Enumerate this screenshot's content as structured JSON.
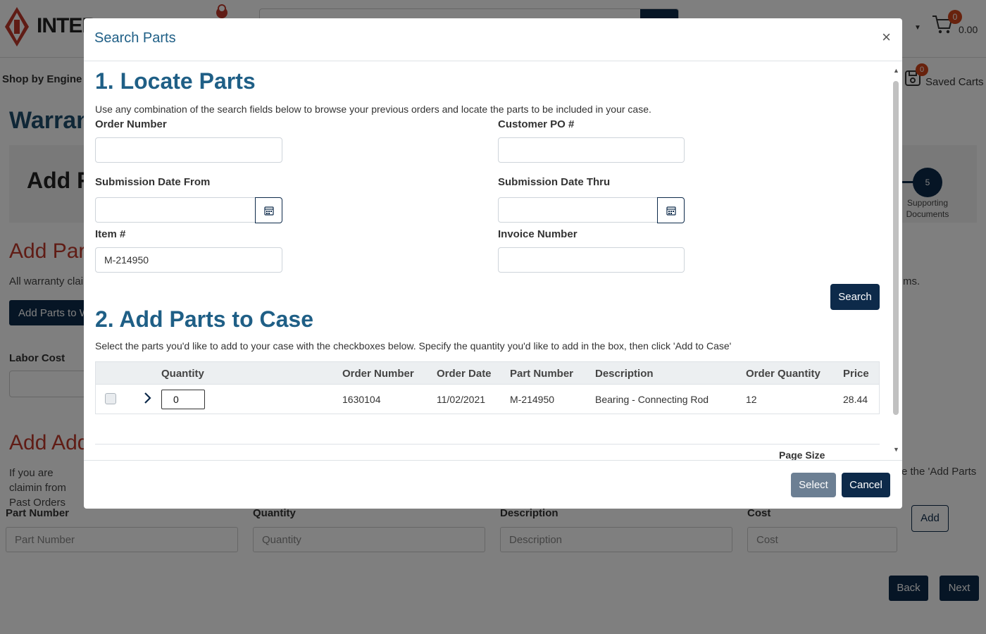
{
  "background": {
    "brand_text": "INTER",
    "nav_shop": "Shop by Engine",
    "cart_badge": "0",
    "cart_total": "0.00",
    "saved_badge": "0",
    "saved_label": "Saved Carts",
    "page_title": "Warran",
    "step_heading": "Add F",
    "step_number": "5",
    "step_label": "Supporting Documents",
    "section1_title": "Add Par",
    "section1_text": "All warranty clair",
    "section1_text_right": "ms.",
    "add_parts_button": "Add Parts to W",
    "labor_label": "Labor Cost",
    "section2_title": "Add Add",
    "section2_text": "If you are claimin from Past Orders",
    "section2_text_right": "e the 'Add Parts",
    "fields": [
      {
        "label": "Part Number",
        "placeholder": "Part Number"
      },
      {
        "label": "Quantity",
        "placeholder": "Quantity"
      },
      {
        "label": "Description",
        "placeholder": "Description"
      },
      {
        "label": "Cost",
        "placeholder": "Cost"
      }
    ],
    "add_button": "Add",
    "back_button": "Back",
    "next_button": "Next",
    "accent": "#0d2a4a",
    "section_color": "#c0392b"
  },
  "modal": {
    "title": "Search Parts",
    "close": "×",
    "section1": {
      "heading": "1. Locate Parts",
      "intro": "Use any combination of the search fields below to browse your previous orders and locate the parts to be included in your case.",
      "order_number_label": "Order Number",
      "order_number_value": "",
      "customer_po_label": "Customer PO #",
      "customer_po_value": "",
      "date_from_label": "Submission Date From",
      "date_from_value": "",
      "date_thru_label": "Submission Date Thru",
      "date_thru_value": "",
      "item_label": "Item #",
      "item_value": "M-214950",
      "invoice_label": "Invoice Number",
      "invoice_value": "",
      "search_button": "Search"
    },
    "section2": {
      "heading": "2. Add Parts to Case",
      "intro": "Select the parts you'd like to add to your case with the checkboxes below. Specify the quantity you'd like to add in the box, then click 'Add to Case'",
      "columns": [
        "Quantity",
        "Order Number",
        "Order Date",
        "Part Number",
        "Description",
        "Order Quantity",
        "Price"
      ],
      "rows": [
        {
          "quantity": "0",
          "order_number": "1630104",
          "order_date": "11/02/2021",
          "part_number": "M-214950",
          "description": "Bearing - Connecting Rod",
          "order_quantity": "12",
          "price": "28.44"
        }
      ],
      "page_size_label": "Page Size",
      "page_size_value": ""
    },
    "footer": {
      "select_button": "Select",
      "cancel_button": "Cancel"
    },
    "title_color": "#1f5f86"
  }
}
